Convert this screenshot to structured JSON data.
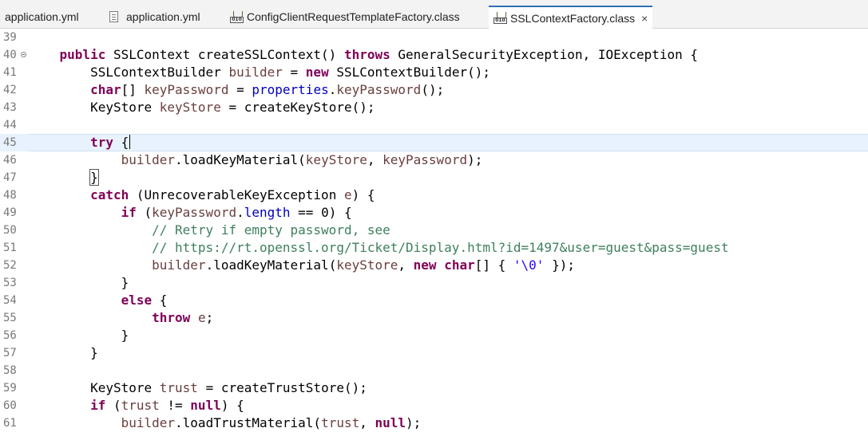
{
  "tabs": [
    {
      "label": "application.yml",
      "icon": "none"
    },
    {
      "label": "application.yml",
      "icon": "file-icon"
    },
    {
      "label": "ConfigClientRequestTemplateFactory.class",
      "icon": "class-file-icon"
    },
    {
      "label": "SSLContextFactory.class",
      "icon": "class-file-icon",
      "active": true,
      "close": "×"
    }
  ],
  "editor": {
    "current_line": 45,
    "lines": [
      {
        "n": "39",
        "t": ""
      },
      {
        "n": "40",
        "t": "    public SSLContext createSSLContext() throws GeneralSecurityException, IOException {"
      },
      {
        "n": "41",
        "t": "        SSLContextBuilder builder = new SSLContextBuilder();"
      },
      {
        "n": "42",
        "t": "        char[] keyPassword = properties.keyPassword();"
      },
      {
        "n": "43",
        "t": "        KeyStore keyStore = createKeyStore();"
      },
      {
        "n": "44",
        "t": ""
      },
      {
        "n": "45",
        "t": "        try {"
      },
      {
        "n": "46",
        "t": "            builder.loadKeyMaterial(keyStore, keyPassword);"
      },
      {
        "n": "47",
        "t": "        }"
      },
      {
        "n": "48",
        "t": "        catch (UnrecoverableKeyException e) {"
      },
      {
        "n": "49",
        "t": "            if (keyPassword.length == 0) {"
      },
      {
        "n": "50",
        "t": "                // Retry if empty password, see"
      },
      {
        "n": "51",
        "t": "                // https://rt.openssl.org/Ticket/Display.html?id=1497&user=guest&pass=guest"
      },
      {
        "n": "52",
        "t": "                builder.loadKeyMaterial(keyStore, new char[] { '\\0' });"
      },
      {
        "n": "53",
        "t": "            }"
      },
      {
        "n": "54",
        "t": "            else {"
      },
      {
        "n": "55",
        "t": "                throw e;"
      },
      {
        "n": "56",
        "t": "            }"
      },
      {
        "n": "57",
        "t": "        }"
      },
      {
        "n": "58",
        "t": ""
      },
      {
        "n": "59",
        "t": "        KeyStore trust = createTrustStore();"
      },
      {
        "n": "60",
        "t": "        if (trust != null) {"
      },
      {
        "n": "61",
        "t": "            builder.loadTrustMaterial(trust, null);"
      }
    ]
  }
}
